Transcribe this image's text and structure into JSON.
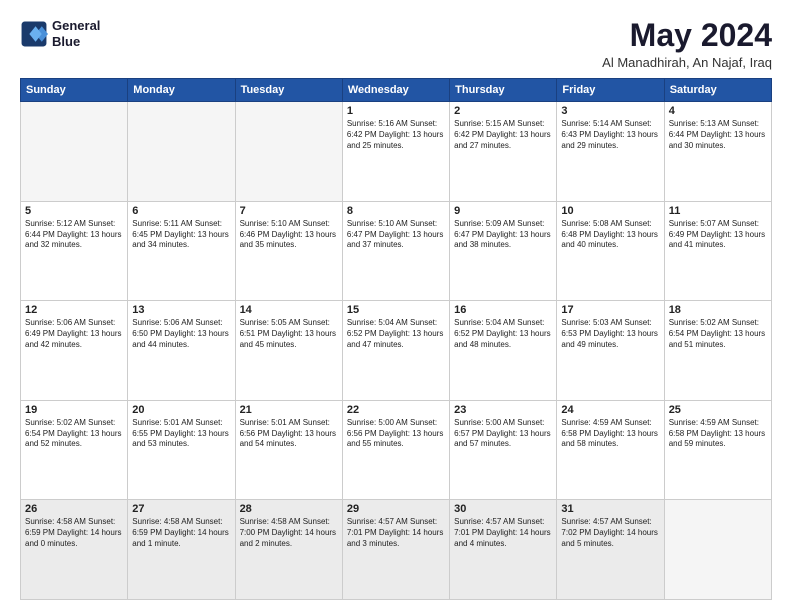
{
  "logo": {
    "line1": "General",
    "line2": "Blue"
  },
  "title": "May 2024",
  "subtitle": "Al Manadhirah, An Najaf, Iraq",
  "headers": [
    "Sunday",
    "Monday",
    "Tuesday",
    "Wednesday",
    "Thursday",
    "Friday",
    "Saturday"
  ],
  "weeks": [
    [
      {
        "day": "",
        "text": ""
      },
      {
        "day": "",
        "text": ""
      },
      {
        "day": "",
        "text": ""
      },
      {
        "day": "1",
        "text": "Sunrise: 5:16 AM\nSunset: 6:42 PM\nDaylight: 13 hours\nand 25 minutes."
      },
      {
        "day": "2",
        "text": "Sunrise: 5:15 AM\nSunset: 6:42 PM\nDaylight: 13 hours\nand 27 minutes."
      },
      {
        "day": "3",
        "text": "Sunrise: 5:14 AM\nSunset: 6:43 PM\nDaylight: 13 hours\nand 29 minutes."
      },
      {
        "day": "4",
        "text": "Sunrise: 5:13 AM\nSunset: 6:44 PM\nDaylight: 13 hours\nand 30 minutes."
      }
    ],
    [
      {
        "day": "5",
        "text": "Sunrise: 5:12 AM\nSunset: 6:44 PM\nDaylight: 13 hours\nand 32 minutes."
      },
      {
        "day": "6",
        "text": "Sunrise: 5:11 AM\nSunset: 6:45 PM\nDaylight: 13 hours\nand 34 minutes."
      },
      {
        "day": "7",
        "text": "Sunrise: 5:10 AM\nSunset: 6:46 PM\nDaylight: 13 hours\nand 35 minutes."
      },
      {
        "day": "8",
        "text": "Sunrise: 5:10 AM\nSunset: 6:47 PM\nDaylight: 13 hours\nand 37 minutes."
      },
      {
        "day": "9",
        "text": "Sunrise: 5:09 AM\nSunset: 6:47 PM\nDaylight: 13 hours\nand 38 minutes."
      },
      {
        "day": "10",
        "text": "Sunrise: 5:08 AM\nSunset: 6:48 PM\nDaylight: 13 hours\nand 40 minutes."
      },
      {
        "day": "11",
        "text": "Sunrise: 5:07 AM\nSunset: 6:49 PM\nDaylight: 13 hours\nand 41 minutes."
      }
    ],
    [
      {
        "day": "12",
        "text": "Sunrise: 5:06 AM\nSunset: 6:49 PM\nDaylight: 13 hours\nand 42 minutes."
      },
      {
        "day": "13",
        "text": "Sunrise: 5:06 AM\nSunset: 6:50 PM\nDaylight: 13 hours\nand 44 minutes."
      },
      {
        "day": "14",
        "text": "Sunrise: 5:05 AM\nSunset: 6:51 PM\nDaylight: 13 hours\nand 45 minutes."
      },
      {
        "day": "15",
        "text": "Sunrise: 5:04 AM\nSunset: 6:52 PM\nDaylight: 13 hours\nand 47 minutes."
      },
      {
        "day": "16",
        "text": "Sunrise: 5:04 AM\nSunset: 6:52 PM\nDaylight: 13 hours\nand 48 minutes."
      },
      {
        "day": "17",
        "text": "Sunrise: 5:03 AM\nSunset: 6:53 PM\nDaylight: 13 hours\nand 49 minutes."
      },
      {
        "day": "18",
        "text": "Sunrise: 5:02 AM\nSunset: 6:54 PM\nDaylight: 13 hours\nand 51 minutes."
      }
    ],
    [
      {
        "day": "19",
        "text": "Sunrise: 5:02 AM\nSunset: 6:54 PM\nDaylight: 13 hours\nand 52 minutes."
      },
      {
        "day": "20",
        "text": "Sunrise: 5:01 AM\nSunset: 6:55 PM\nDaylight: 13 hours\nand 53 minutes."
      },
      {
        "day": "21",
        "text": "Sunrise: 5:01 AM\nSunset: 6:56 PM\nDaylight: 13 hours\nand 54 minutes."
      },
      {
        "day": "22",
        "text": "Sunrise: 5:00 AM\nSunset: 6:56 PM\nDaylight: 13 hours\nand 55 minutes."
      },
      {
        "day": "23",
        "text": "Sunrise: 5:00 AM\nSunset: 6:57 PM\nDaylight: 13 hours\nand 57 minutes."
      },
      {
        "day": "24",
        "text": "Sunrise: 4:59 AM\nSunset: 6:58 PM\nDaylight: 13 hours\nand 58 minutes."
      },
      {
        "day": "25",
        "text": "Sunrise: 4:59 AM\nSunset: 6:58 PM\nDaylight: 13 hours\nand 59 minutes."
      }
    ],
    [
      {
        "day": "26",
        "text": "Sunrise: 4:58 AM\nSunset: 6:59 PM\nDaylight: 14 hours\nand 0 minutes."
      },
      {
        "day": "27",
        "text": "Sunrise: 4:58 AM\nSunset: 6:59 PM\nDaylight: 14 hours\nand 1 minute."
      },
      {
        "day": "28",
        "text": "Sunrise: 4:58 AM\nSunset: 7:00 PM\nDaylight: 14 hours\nand 2 minutes."
      },
      {
        "day": "29",
        "text": "Sunrise: 4:57 AM\nSunset: 7:01 PM\nDaylight: 14 hours\nand 3 minutes."
      },
      {
        "day": "30",
        "text": "Sunrise: 4:57 AM\nSunset: 7:01 PM\nDaylight: 14 hours\nand 4 minutes."
      },
      {
        "day": "31",
        "text": "Sunrise: 4:57 AM\nSunset: 7:02 PM\nDaylight: 14 hours\nand 5 minutes."
      },
      {
        "day": "",
        "text": ""
      }
    ]
  ]
}
